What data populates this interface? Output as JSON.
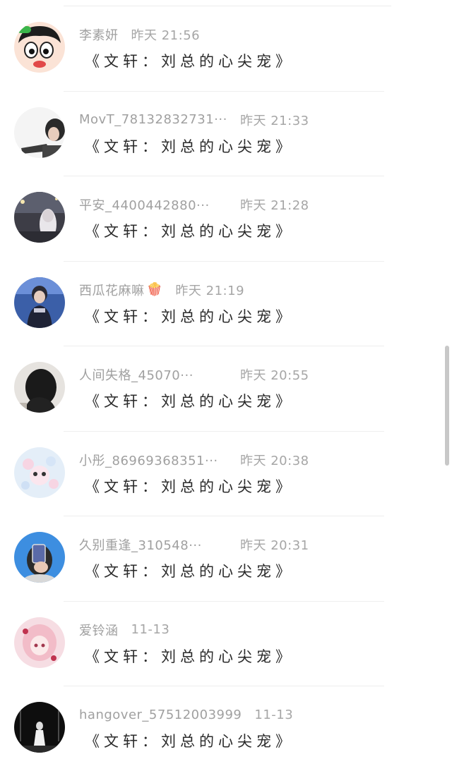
{
  "colors": {
    "background": "#ffffff",
    "username": "#a0a0a0",
    "comment_text": "#2a2a2a",
    "divider": "#eeeeee"
  },
  "comments": [
    {
      "username": "李素妍",
      "time": "昨天 21:56",
      "text": "《文轩：刘总的心尖宠》",
      "avatar": "cartoon-boy-avatar"
    },
    {
      "username": "MovT_78132832731···",
      "time": "昨天 21:33",
      "text": "《文轩：刘总的心尖宠》",
      "avatar": "photo-person-avatar"
    },
    {
      "username": "平安_4400442880···",
      "time": "昨天 21:28",
      "text": "《文轩：刘总的心尖宠》",
      "avatar": "night-street-avatar"
    },
    {
      "username": "西瓜花麻嘛",
      "time": "昨天 21:19",
      "text": "《文轩：刘总的心尖宠》",
      "avatar": "stage-performer-avatar",
      "emoji": "🍿"
    },
    {
      "username": "人间失格_45070···",
      "time": "昨天 20:55",
      "text": "《文轩：刘总的心尖宠》",
      "avatar": "dark-hair-avatar"
    },
    {
      "username": "小彤_86969368351···",
      "time": "昨天 20:38",
      "text": "《文轩：刘总的心尖宠》",
      "avatar": "floral-pastel-avatar"
    },
    {
      "username": "久别重逢_310548···",
      "time": "昨天 20:31",
      "text": "《文轩：刘总的心尖宠》",
      "avatar": "selfie-phone-avatar"
    },
    {
      "username": "爱铃涵",
      "time": "11-13",
      "text": "《文轩：刘总的心尖宠》",
      "avatar": "pink-anime-avatar"
    },
    {
      "username": "hangover_57512003999",
      "time": "11-13",
      "text": "《文轩：刘总的心尖宠》",
      "avatar": "dark-stage-avatar"
    }
  ]
}
